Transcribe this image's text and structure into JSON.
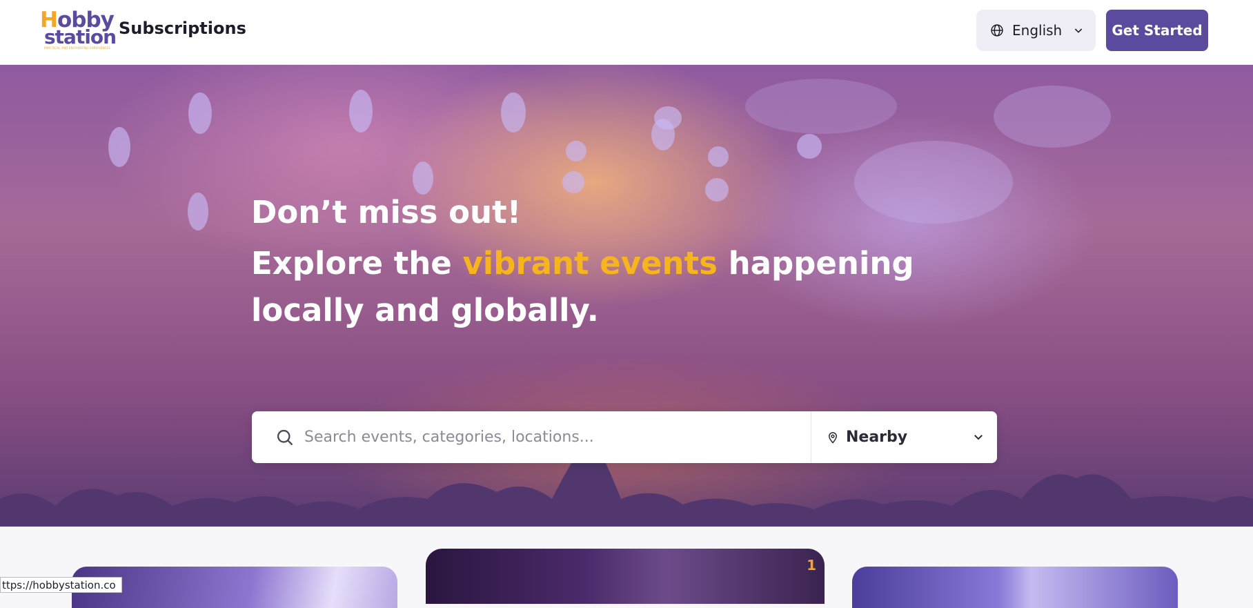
{
  "header": {
    "logo": {
      "top": "Hobby",
      "bottom": "station",
      "tagline": "PRACTICAL AND ENCHANTING EXPERIENCES"
    },
    "title": "Subscriptions",
    "language": {
      "label": "English",
      "icon": "globe-icon",
      "chevron": "chevron-down-icon"
    },
    "cta_label": "Get Started"
  },
  "hero": {
    "headline": "Don’t miss out!",
    "subline_prefix": "Explore the",
    "subline_accent": "vibrant events",
    "subline_suffix": "happening locally and globally.",
    "accent_color": "#f6b51e",
    "search": {
      "placeholder": "Search events, categories, locations...",
      "icon": "search-icon",
      "location": {
        "label": "Nearby",
        "icon": "map-pin-icon",
        "chevron": "chevron-down-icon"
      }
    }
  },
  "cards": [
    {
      "name": "event-card-1"
    },
    {
      "name": "event-card-2",
      "badge": "1"
    },
    {
      "name": "event-card-3"
    }
  ],
  "status_bar": {
    "url": "ttps://hobbystation.co"
  },
  "colors": {
    "brand": "#5b4a9e",
    "brand_accent": "#f5a623"
  }
}
